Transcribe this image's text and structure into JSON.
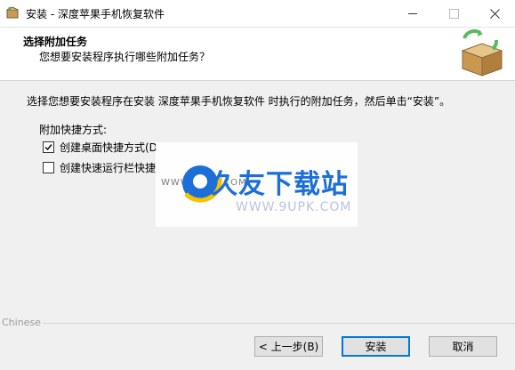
{
  "window": {
    "title": "安装 - 深度苹果手机恢复软件"
  },
  "header": {
    "title": "选择附加任务",
    "subtitle": "您想要安装程序执行哪些附加任务？"
  },
  "body": {
    "description": "选择您想要安装程序在安装 深度苹果手机恢复软件 时执行的附加任务，然后单击“安装”。",
    "group_label": "附加快捷方式:",
    "options": [
      {
        "label": "创建桌面快捷方式(D",
        "checked": true
      },
      {
        "label": "创建快速运行栏快捷",
        "checked": false
      }
    ]
  },
  "watermark": {
    "cn": "久友下载站",
    "en": "WWW.9UPK.COM",
    "small": "WWW.9UPK.COM"
  },
  "footer": {
    "language": "Chinese",
    "back": "< 上一步(B)",
    "install": "安装",
    "cancel": "取消"
  },
  "colors": {
    "accent": "#0078d7",
    "watermark_blue": "#1c6fd6"
  }
}
